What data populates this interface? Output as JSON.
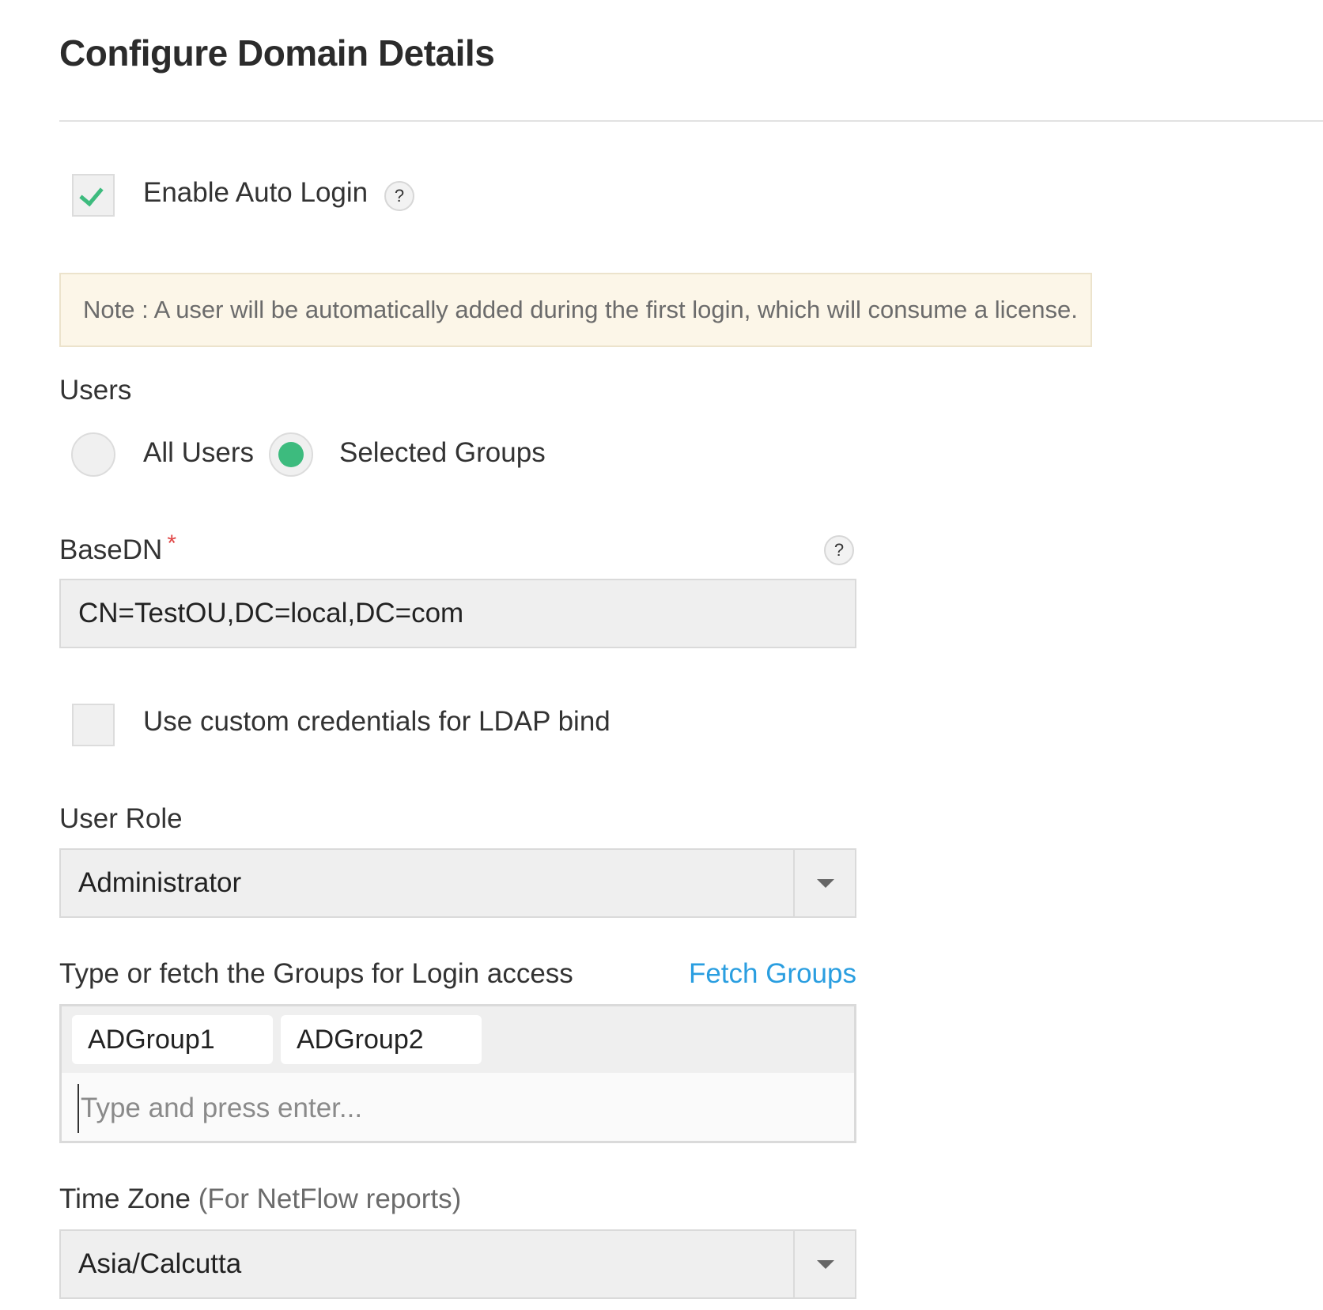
{
  "header": {
    "title": "Configure Domain Details"
  },
  "auto_login": {
    "label": "Enable Auto Login",
    "checked": true,
    "help": "?"
  },
  "note": {
    "text": "Note : A user will be automatically added during the first login, which will consume a license."
  },
  "users": {
    "label": "Users",
    "options": [
      {
        "label": "All Users",
        "selected": false
      },
      {
        "label": "Selected Groups",
        "selected": true
      }
    ]
  },
  "basedn": {
    "label": "BaseDN",
    "required_mark": "*",
    "help": "?",
    "value": "CN=TestOU,DC=local,DC=com"
  },
  "custom_credentials": {
    "label": "Use custom credentials for LDAP bind",
    "checked": false
  },
  "user_role": {
    "label": "User Role",
    "value": "Administrator"
  },
  "groups": {
    "label": "Type or fetch the Groups for Login access",
    "fetch_link": "Fetch Groups",
    "tags": [
      "ADGroup1",
      "ADGroup2"
    ],
    "placeholder": "Type and press enter..."
  },
  "time_zone": {
    "label": "Time Zone",
    "label_hint": "(For NetFlow reports)",
    "value": "Asia/Calcutta"
  },
  "colors": {
    "accent_green": "#3dbb7e",
    "link_blue": "#2a9ee0",
    "required_red": "#e04646",
    "note_bg": "#fcf6e8"
  }
}
